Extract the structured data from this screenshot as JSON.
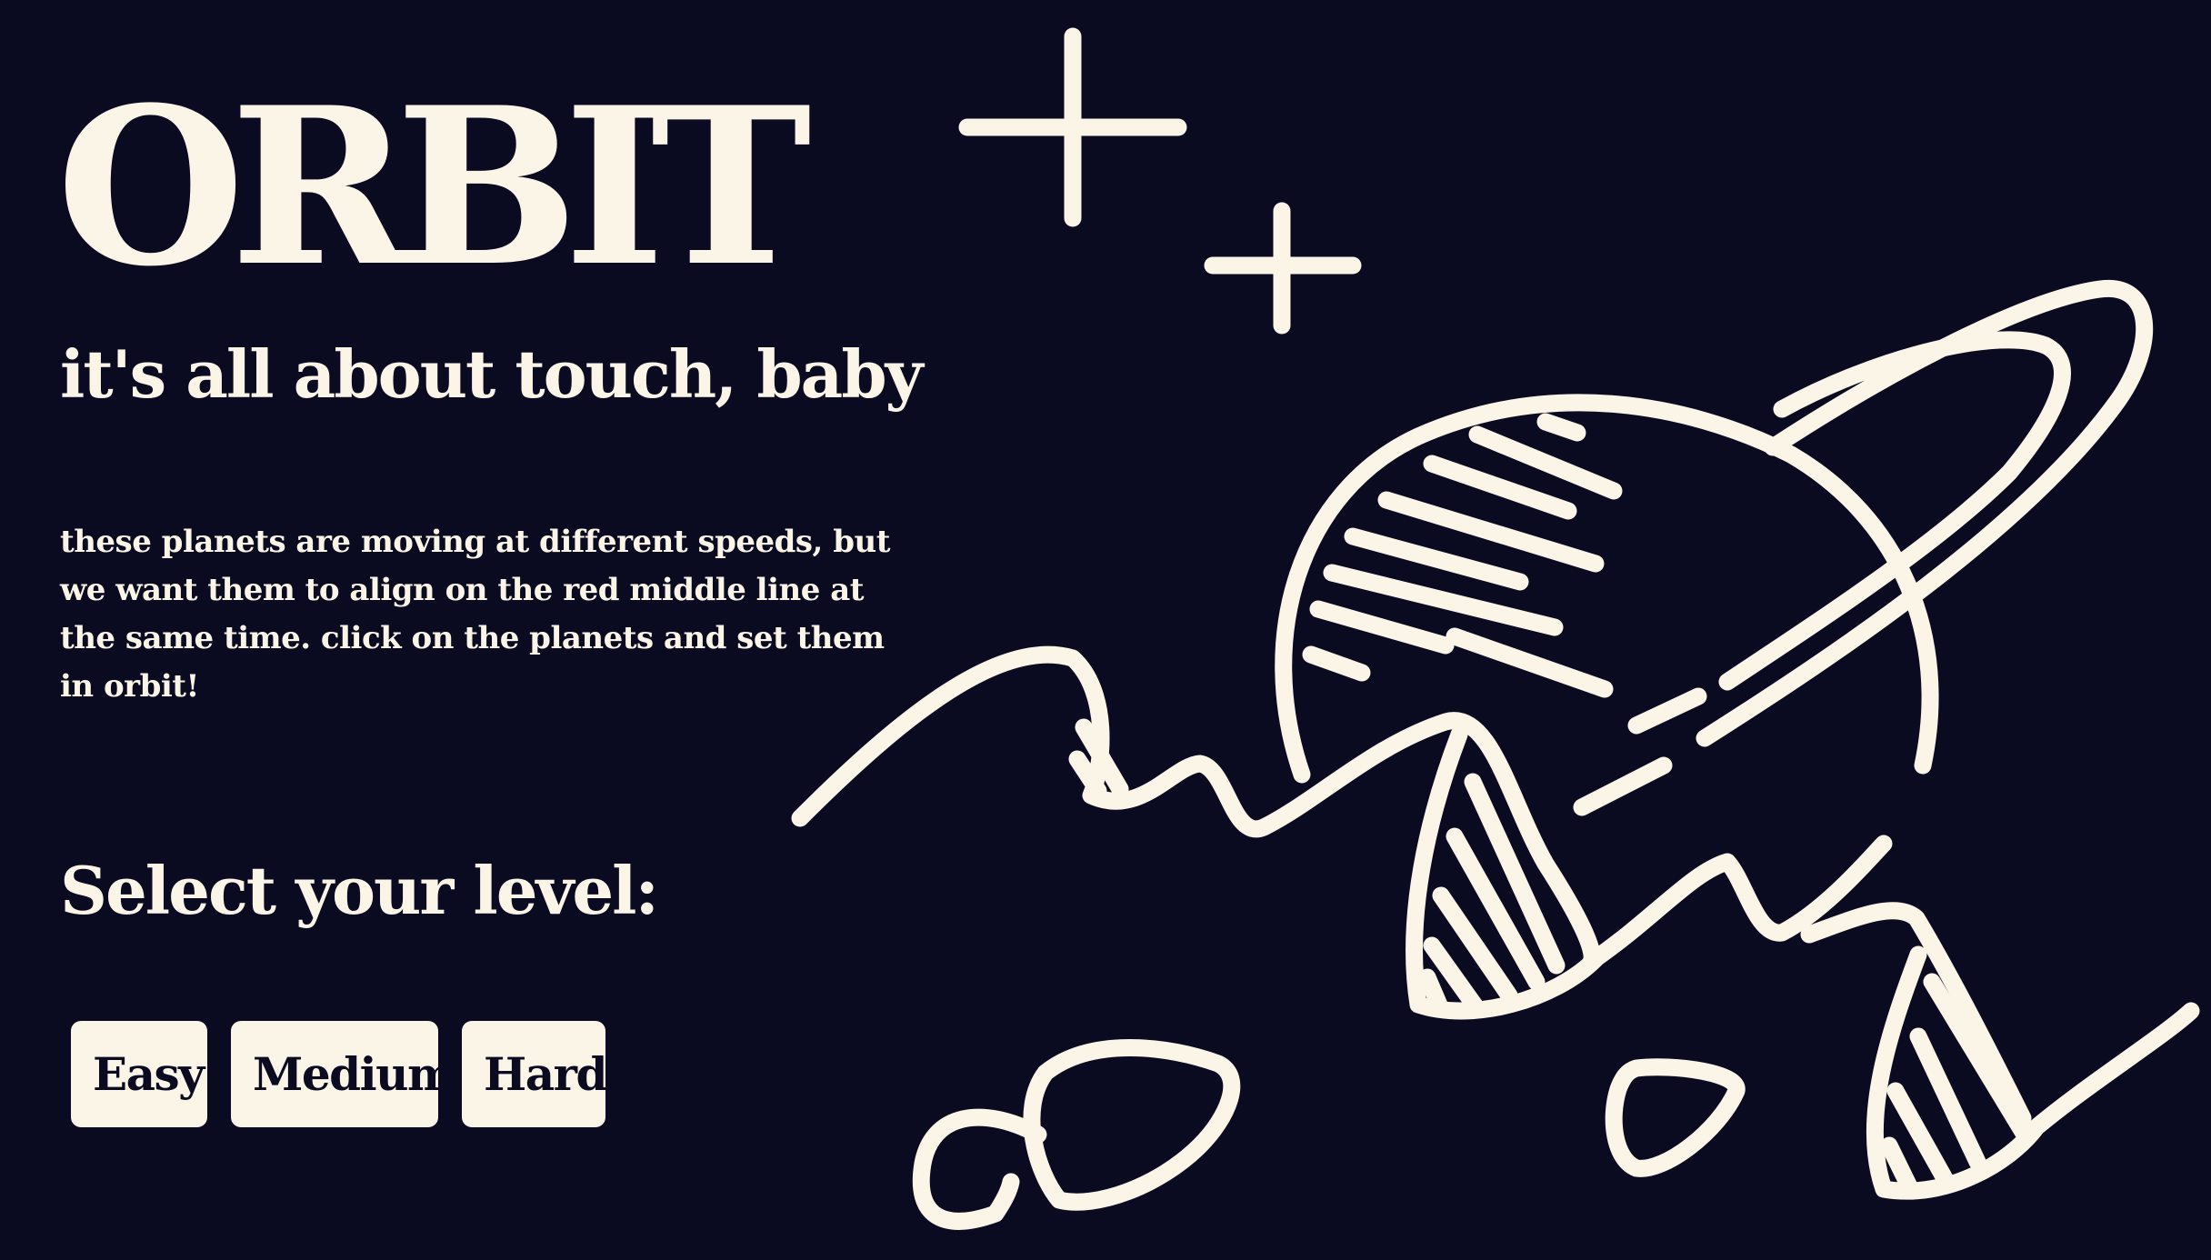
{
  "header": {
    "title": "ORBIT",
    "tagline": "it's all about touch, baby"
  },
  "intro": {
    "description": "these planets are moving at different speeds, but we want them to align on the red middle line at the same time. click on the planets and set them in orbit!"
  },
  "levels": {
    "heading": "Select your level:",
    "options": [
      {
        "label": "Easy"
      },
      {
        "label": "Medium"
      },
      {
        "label": "Hard"
      }
    ]
  },
  "theme": {
    "background": "#0a0a21",
    "foreground": "#fbf5e8"
  }
}
